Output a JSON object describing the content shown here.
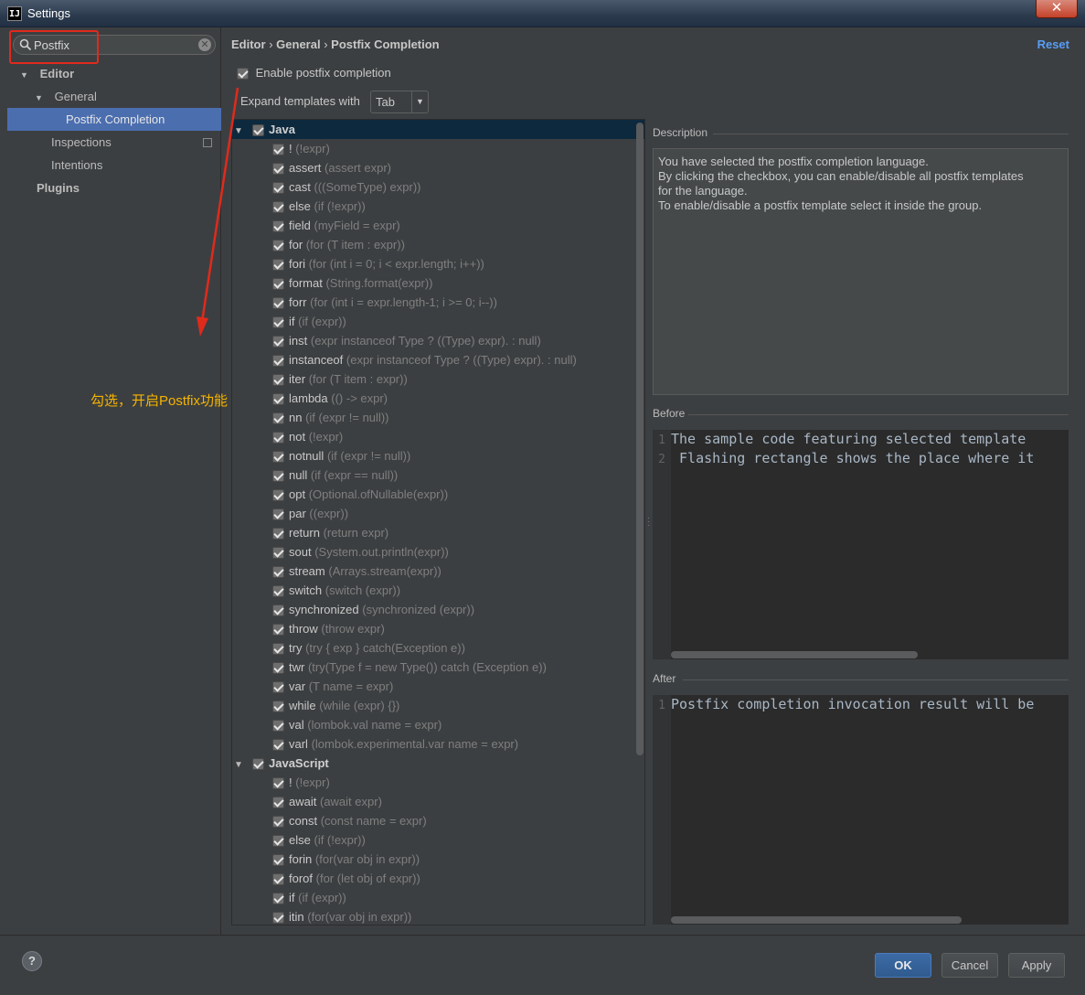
{
  "window": {
    "title": "Settings",
    "app_icon": "IJ",
    "close_glyph": "✕"
  },
  "search": {
    "value": "Postfix",
    "clear_glyph": "✕"
  },
  "tree": {
    "editor": "Editor",
    "general": "General",
    "postfix_completion": "Postfix Completion",
    "inspections": "Inspections",
    "intentions": "Intentions",
    "plugins": "Plugins"
  },
  "breadcrumb": {
    "part1": "Editor",
    "sep": "›",
    "part2": "General",
    "part3": "Postfix Completion"
  },
  "reset_label": "Reset",
  "enable_label": "Enable postfix completion",
  "expand_label": "Expand templates with",
  "expand_value": "Tab",
  "java_group": "Java",
  "java_templates": [
    {
      "name": "!",
      "hint": "(!expr)"
    },
    {
      "name": "assert",
      "hint": "(assert expr)"
    },
    {
      "name": "cast",
      "hint": "(((SomeType) expr))"
    },
    {
      "name": "else",
      "hint": "(if (!expr))"
    },
    {
      "name": "field",
      "hint": "(myField = expr)"
    },
    {
      "name": "for",
      "hint": "(for (T item : expr))"
    },
    {
      "name": "fori",
      "hint": "(for (int i = 0; i < expr.length; i++))"
    },
    {
      "name": "format",
      "hint": "(String.format(expr))"
    },
    {
      "name": "forr",
      "hint": "(for (int i = expr.length-1; i >= 0; i--))"
    },
    {
      "name": "if",
      "hint": "(if (expr))"
    },
    {
      "name": "inst",
      "hint": "(expr instanceof Type ? ((Type) expr). : null)"
    },
    {
      "name": "instanceof",
      "hint": "(expr instanceof Type ? ((Type) expr). : null)"
    },
    {
      "name": "iter",
      "hint": "(for (T item : expr))"
    },
    {
      "name": "lambda",
      "hint": "(() -> expr)"
    },
    {
      "name": "nn",
      "hint": "(if (expr != null))"
    },
    {
      "name": "not",
      "hint": "(!expr)"
    },
    {
      "name": "notnull",
      "hint": "(if (expr != null))"
    },
    {
      "name": "null",
      "hint": "(if (expr == null))"
    },
    {
      "name": "opt",
      "hint": "(Optional.ofNullable(expr))"
    },
    {
      "name": "par",
      "hint": "((expr))"
    },
    {
      "name": "return",
      "hint": "(return expr)"
    },
    {
      "name": "sout",
      "hint": "(System.out.println(expr))"
    },
    {
      "name": "stream",
      "hint": "(Arrays.stream(expr))"
    },
    {
      "name": "switch",
      "hint": "(switch (expr))"
    },
    {
      "name": "synchronized",
      "hint": "(synchronized (expr))"
    },
    {
      "name": "throw",
      "hint": "(throw expr)"
    },
    {
      "name": "try",
      "hint": "(try { exp } catch(Exception e))"
    },
    {
      "name": "twr",
      "hint": "(try(Type f = new Type()) catch (Exception e))"
    },
    {
      "name": "var",
      "hint": "(T name = expr)"
    },
    {
      "name": "while",
      "hint": "(while (expr) {})"
    },
    {
      "name": "val",
      "hint": "(lombok.val name = expr)"
    },
    {
      "name": "varl",
      "hint": "(lombok.experimental.var name = expr)"
    }
  ],
  "js_group": "JavaScript",
  "js_templates": [
    {
      "name": "!",
      "hint": "(!expr)"
    },
    {
      "name": "await",
      "hint": "(await expr)"
    },
    {
      "name": "const",
      "hint": "(const name = expr)"
    },
    {
      "name": "else",
      "hint": "(if (!expr))"
    },
    {
      "name": "forin",
      "hint": "(for(var obj in expr))"
    },
    {
      "name": "forof",
      "hint": "(for (let obj of expr))"
    },
    {
      "name": "if",
      "hint": "(if (expr))"
    },
    {
      "name": "itin",
      "hint": "(for(var obj in expr))"
    }
  ],
  "description": {
    "label": "Description",
    "lines": [
      "You have selected the postfix completion language.",
      "By clicking the checkbox, you can enable/disable all postfix templates",
      "for the language.",
      "To enable/disable a postfix template select it inside the group."
    ]
  },
  "before": {
    "label": "Before",
    "lines": [
      {
        "num": "1",
        "text": "The sample code featuring selected template"
      },
      {
        "num": "2",
        "text": " Flashing rectangle shows the place where it"
      }
    ]
  },
  "after": {
    "label": "After",
    "lines": [
      {
        "num": "1",
        "text": "Postfix completion invocation result will be"
      }
    ]
  },
  "annotation": "勾选，开启Postfix功能",
  "buttons": {
    "ok": "OK",
    "cancel": "Cancel",
    "apply": "Apply",
    "help": "?"
  },
  "colors": {
    "accent": "#4b6eaf",
    "annotation_red": "#e02a1c",
    "annotation_text": "#f5b400",
    "link": "#589df6"
  }
}
